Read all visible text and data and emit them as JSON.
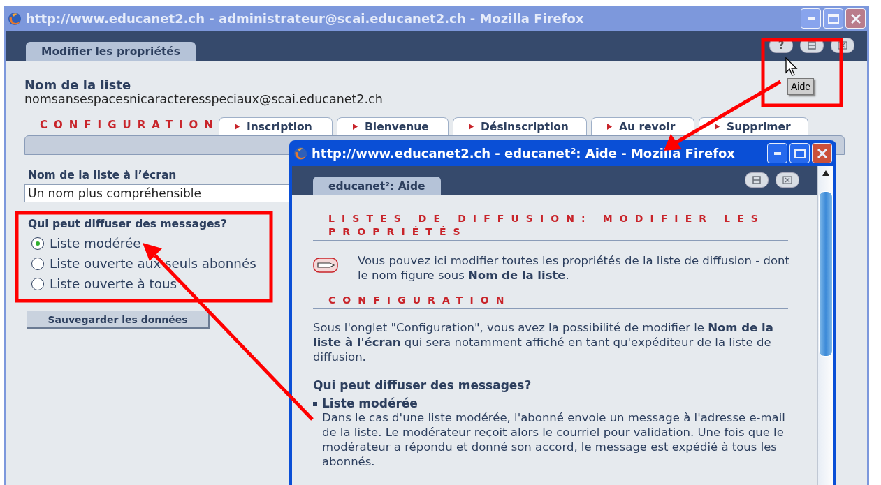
{
  "main_window": {
    "title": "http://www.educanet2.ch - administrateur@scai.educanet2.ch - Mozilla Firefox",
    "page_tab": "Modifier les propriétés",
    "help_button": "?",
    "tooltip": "Aide",
    "list_name_label": "Nom de la liste",
    "list_address": "nomsansespacesnicaracteresspeciaux@scai.educanet2.ch",
    "tabs": [
      {
        "label": "CONFIGURATION",
        "selected": true
      },
      {
        "label": "Inscription",
        "selected": false
      },
      {
        "label": "Bienvenue",
        "selected": false
      },
      {
        "label": "Désinscription",
        "selected": false
      },
      {
        "label": "Au revoir",
        "selected": false
      },
      {
        "label": "Supprimer",
        "selected": false
      }
    ],
    "display_name": {
      "label": "Nom de la liste à l’écran",
      "value": "Un nom plus compréhensible"
    },
    "broadcast": {
      "label": "Qui peut diffuser des messages?",
      "options": [
        {
          "label": "Liste modérée",
          "selected": true
        },
        {
          "label": "Liste ouverte aux seuls abonnés",
          "selected": false
        },
        {
          "label": "Liste ouverte à tous",
          "selected": false
        }
      ]
    },
    "save_button": "Sauvegarder les données"
  },
  "help_window": {
    "title": "http://www.educanet2.ch - educanet²: Aide - Mozilla Firefox",
    "page_tab": "educanet²: Aide",
    "heading": "LISTES DE DIFFUSION: MODIFIER LES PROPRIÉTÉS",
    "intro": "Vous pouvez ici modifier toutes les propriétés de la liste de diffusion - dont le nom figure sous **Nom de la liste**.",
    "section_title": "CONFIGURATION",
    "config_text": "Sous l'onglet \"Configuration\", vous avez la possibilité de modifier le **Nom de la liste à l'écran** qui sera notamment affiché en tant qu'expéditeur de la liste de diffusion.",
    "subheading": "Qui peut diffuser des messages?",
    "items": [
      {
        "title": "Liste modérée",
        "text": "Dans le cas d'une liste modérée, l'abonné envoie un message à l'adresse e-mail de la liste. Le modérateur reçoit alors le courriel pour validation. Une fois que le modérateur a répondu et donné son accord, le message est expédié à tous les abonnés."
      }
    ]
  }
}
